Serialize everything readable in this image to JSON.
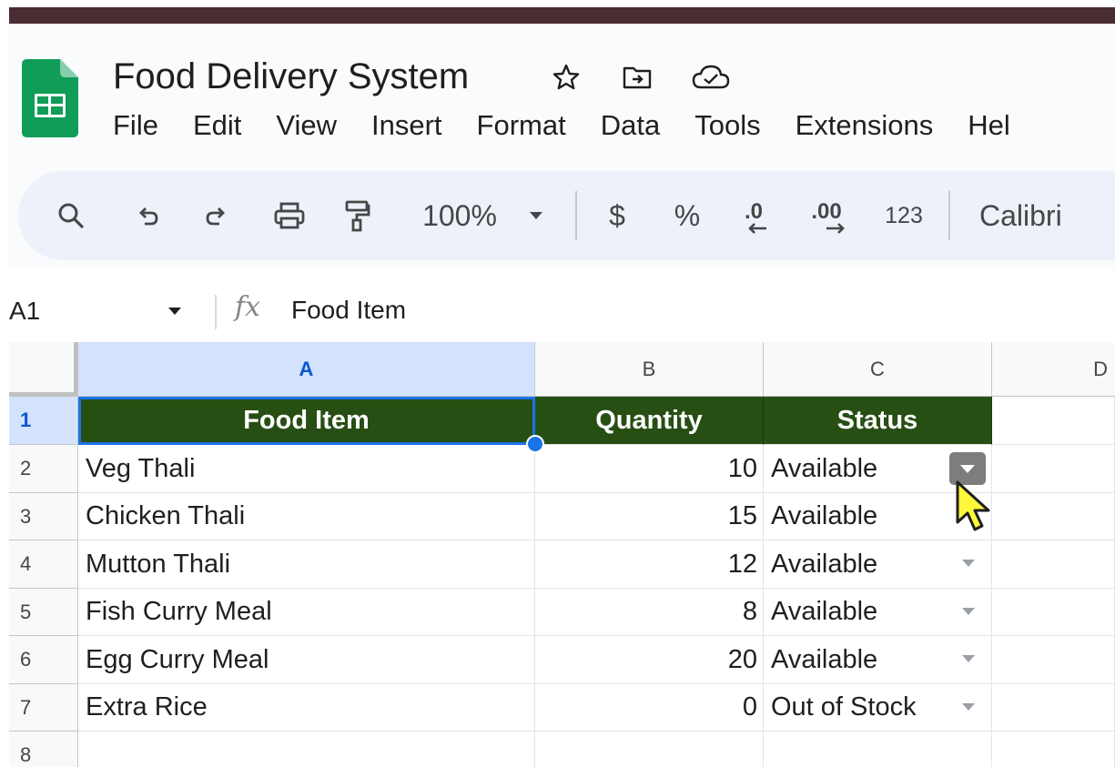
{
  "doc": {
    "title": "Food Delivery System",
    "icons": [
      "star-icon",
      "move-to-folder-icon",
      "cloud-saved-icon"
    ]
  },
  "menu": [
    "File",
    "Edit",
    "View",
    "Insert",
    "Format",
    "Data",
    "Tools",
    "Extensions",
    "Hel"
  ],
  "toolbar": {
    "zoom": "100%",
    "currency": "$",
    "percent": "%",
    "decrease_decimal": ".0",
    "increase_decimal": ".00",
    "number_format": "123",
    "font": "Calibri"
  },
  "formula_bar": {
    "cell_ref": "A1",
    "fx_label": "fx",
    "value": "Food Item"
  },
  "grid": {
    "columns": [
      "A",
      "B",
      "C",
      "D"
    ],
    "rows": [
      "1",
      "2",
      "3",
      "4",
      "5",
      "6",
      "7",
      "8"
    ],
    "headers": [
      "Food Item",
      "Quantity",
      "Status"
    ],
    "data": [
      {
        "item": "Veg Thali",
        "qty": "10",
        "status": "Available"
      },
      {
        "item": "Chicken Thali",
        "qty": "15",
        "status": "Available"
      },
      {
        "item": "Mutton Thali",
        "qty": "12",
        "status": "Available"
      },
      {
        "item": "Fish Curry Meal",
        "qty": "8",
        "status": "Available"
      },
      {
        "item": "Egg Curry Meal",
        "qty": "20",
        "status": "Available"
      },
      {
        "item": "Extra Rice",
        "qty": "0",
        "status": "Out of Stock"
      }
    ]
  },
  "colors": {
    "header_fill": "#274e13",
    "selection": "#1a73e8",
    "brand_green": "#0f9d58"
  }
}
